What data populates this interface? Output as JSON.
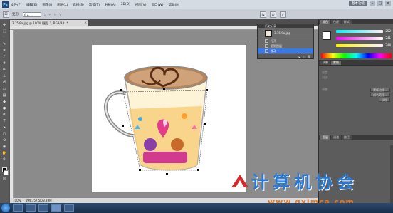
{
  "app": {
    "logo": "Ps"
  },
  "menu": [
    "文件(F)",
    "编辑(E)",
    "图像(I)",
    "图层(L)",
    "选择(S)",
    "滤镜(T)",
    "分析(A)",
    "3D(D)",
    "视图(V)",
    "窗口(W)",
    "帮助(H)"
  ],
  "workspace": {
    "essentials": "基本功能"
  },
  "options": {
    "mode_label": "变形:",
    "mode_value": "自定"
  },
  "document": {
    "tab_title": "3.15.9a.jpg @ 100% (图层 1, RGB/8#) *",
    "status_zoom": "100%",
    "status_doc": "文档:757.5K/3.39M"
  },
  "history": {
    "title": "历史记录",
    "snapshot_name": "3.15.9a.jpg",
    "rows": [
      "打开",
      "粘贴图层",
      "移动"
    ],
    "active_index": 2
  },
  "color_panel": {
    "tabs": [
      "颜色",
      "色板",
      "样式"
    ],
    "active_tab": 0,
    "values": [
      "252",
      "241",
      "248"
    ]
  },
  "adjust_panel": {
    "tabs": [
      "调整",
      "蒙版"
    ],
    "active_tab": 1,
    "rows": [
      "浓度:",
      "羽化:",
      "调整:"
    ],
    "buttons": [
      "蒙版边缘...",
      "颜色范围...",
      "反相"
    ]
  },
  "layers_panel": {
    "tabs": [
      "图层",
      "通道",
      "路径"
    ],
    "active_tab": 0
  },
  "watermark": {
    "text": "计算机协会",
    "url": "www.gxjmca.com"
  },
  "colors": {
    "accent": "#3b78e7",
    "watermark_blue": "#2a78d2",
    "watermark_orange": "#e87a22"
  }
}
